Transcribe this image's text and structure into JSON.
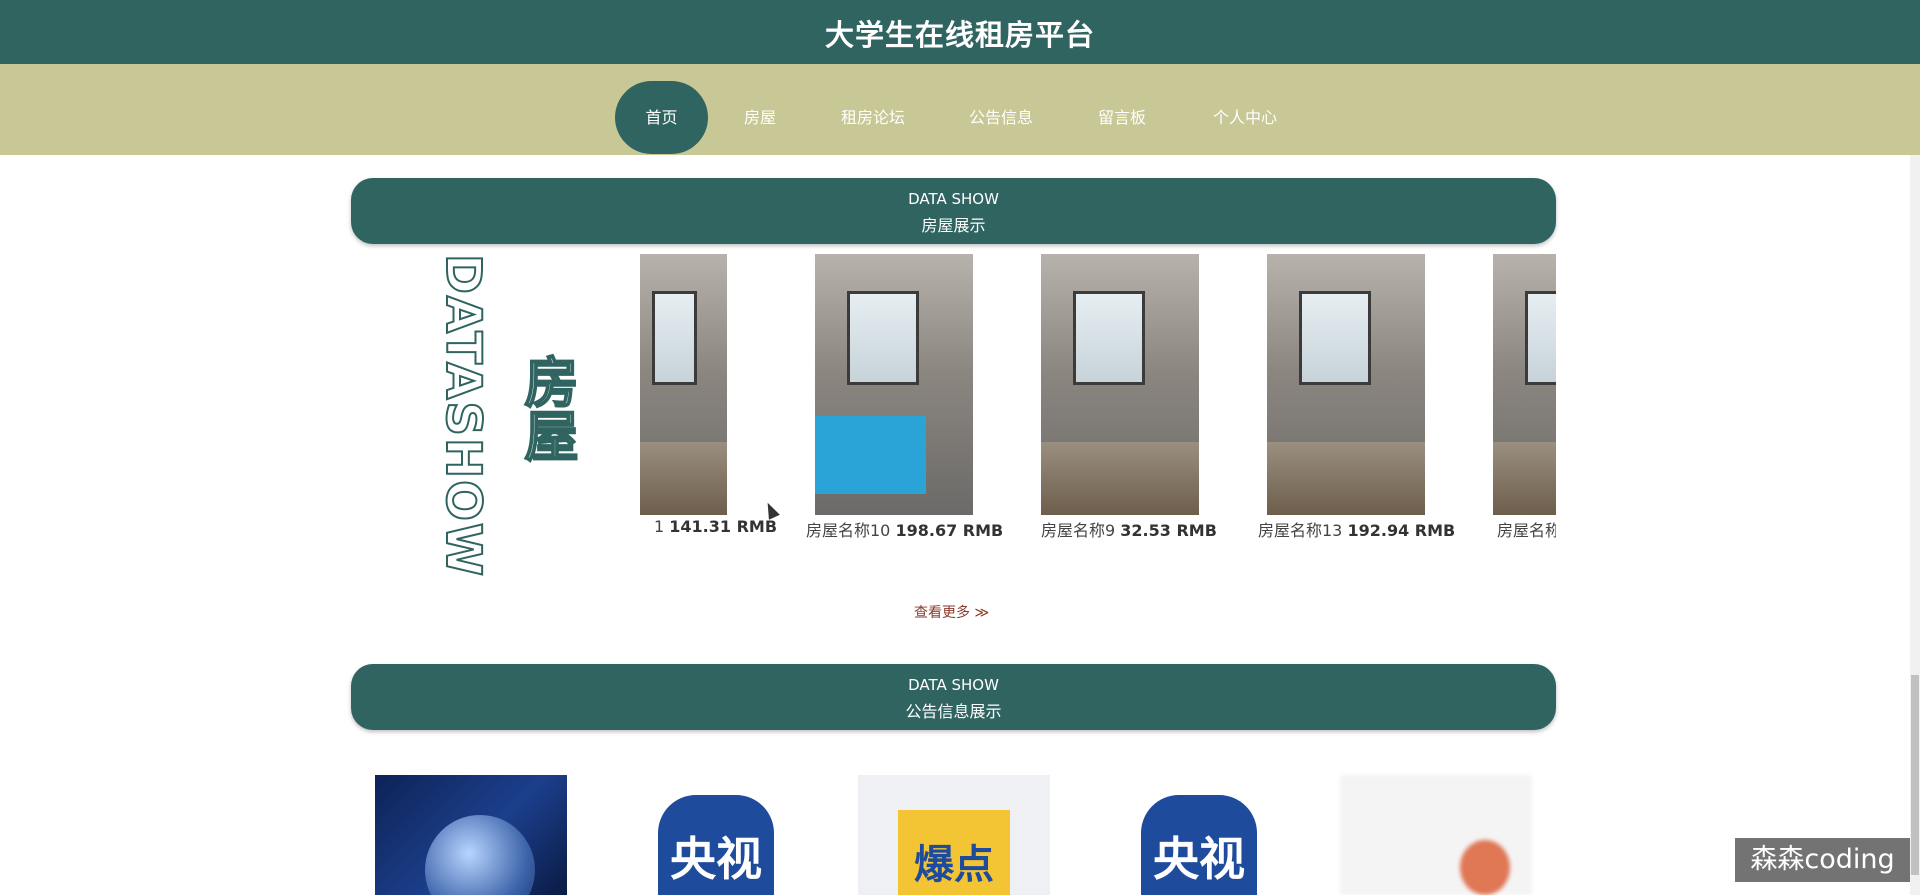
{
  "header": {
    "title": "大学生在线租房平台"
  },
  "nav": {
    "items": [
      {
        "label": "首页",
        "active": true
      },
      {
        "label": "房屋"
      },
      {
        "label": "租房论坛"
      },
      {
        "label": "公告信息"
      },
      {
        "label": "留言板"
      },
      {
        "label": "个人中心"
      }
    ]
  },
  "house_section": {
    "en": "DATA SHOW",
    "cn": "房屋展示",
    "vertical_en": "DATASHOW",
    "vertical_cn": "房屋",
    "cards": [
      {
        "name": "1",
        "price": "141.31 RMB"
      },
      {
        "name": "房屋名称10",
        "price": "198.67 RMB"
      },
      {
        "name": "房屋名称9",
        "price": "32.53 RMB"
      },
      {
        "name": "房屋名称13",
        "price": "192.94 RMB"
      },
      {
        "name": "房屋名称",
        "price": ""
      }
    ],
    "more_label": "查看更多 ≫"
  },
  "notice_section": {
    "en": "DATA SHOW",
    "cn": "公告信息展示",
    "thumbs": [
      {
        "type": "globe"
      },
      {
        "type": "brand",
        "text": "央视"
      },
      {
        "type": "burst",
        "text": "爆点"
      },
      {
        "type": "brand",
        "text": "央视"
      },
      {
        "type": "blur"
      }
    ]
  },
  "watermark": "森森coding",
  "colors": {
    "primary": "#2f6461",
    "nav_bg": "#c8c796",
    "more_link": "#8b3a2b"
  }
}
